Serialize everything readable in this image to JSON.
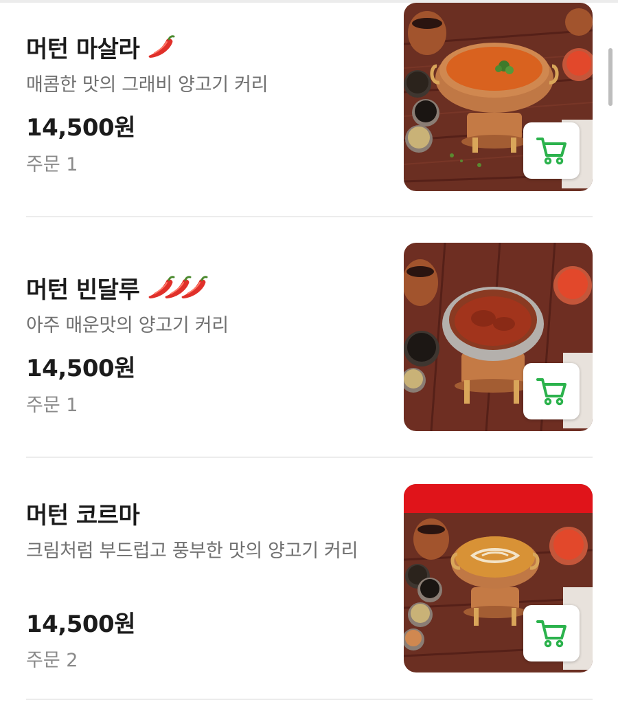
{
  "menu": {
    "items": [
      {
        "name": "머턴 마살라",
        "spice_level": 1,
        "description": "매콤한 맛의 그래비 양고기 커리",
        "price": "14,500원",
        "orders": "주문 1",
        "sauce_color": "#d9621f"
      },
      {
        "name": "머턴 빈달루",
        "spice_level": 3,
        "description": "아주 매운맛의 양고기 커리",
        "price": "14,500원",
        "orders": "주문 1",
        "sauce_color": "#a2341c"
      },
      {
        "name": "머턴 코르마",
        "spice_level": 0,
        "description": "크림처럼 부드럽고 풍부한 맛의 양고기 커리",
        "price": "14,500원",
        "orders": "주문 2",
        "sauce_color": "#d89236"
      }
    ]
  },
  "colors": {
    "accent_green": "#2bb24c",
    "chili_red": "#e0302a",
    "wood_dark": "#5a2b1f",
    "wood_light": "#7a3a2a",
    "copper": "#b86a3a",
    "promo_red": "#e0141a"
  },
  "icons": {
    "cart": "cart-icon",
    "chili": "chili-pepper-icon"
  }
}
